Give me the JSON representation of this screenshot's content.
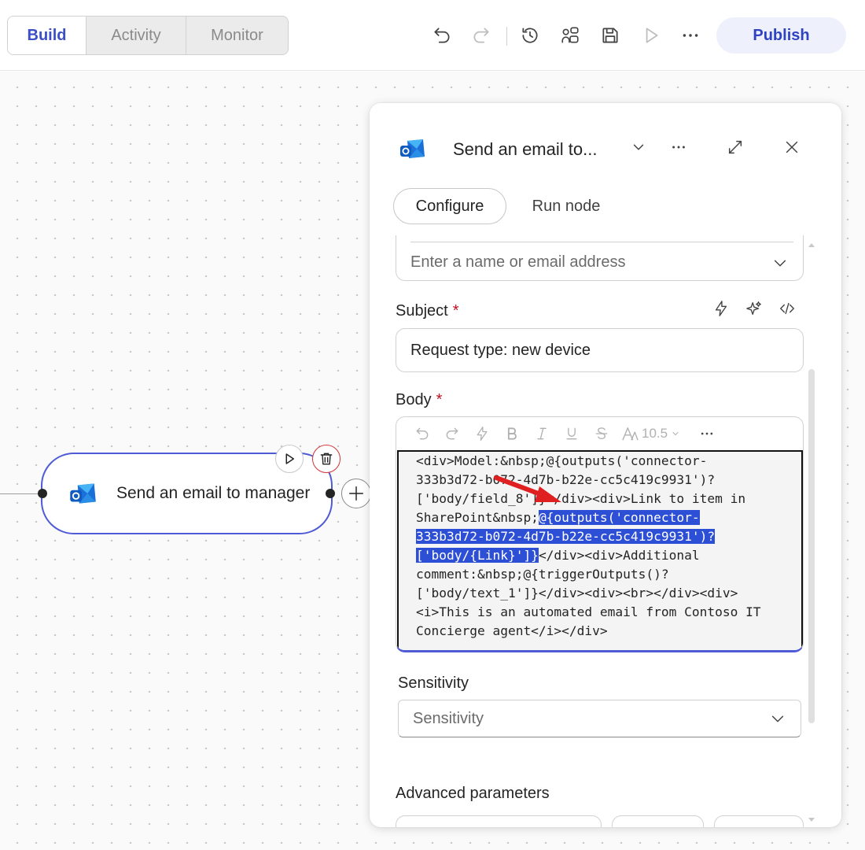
{
  "tabs": [
    {
      "label": "Build",
      "active": true
    },
    {
      "label": "Activity",
      "active": false
    },
    {
      "label": "Monitor",
      "active": false
    }
  ],
  "toolbar": {
    "icons": [
      "undo-icon",
      "redo-icon",
      "version-history-icon",
      "flow-checker-icon",
      "save-icon",
      "test-icon",
      "more-icon"
    ],
    "publish_label": "Publish"
  },
  "node": {
    "label": "Send an email to manager",
    "icon": "outlook-icon",
    "accent": "#4f5bd5"
  },
  "panel": {
    "title": "Send an email to...",
    "tabs": {
      "configure": "Configure",
      "run_node": "Run node"
    },
    "to_placeholder": "Enter a name or email address",
    "subject": {
      "label": "Subject",
      "required": "*",
      "value": "Request type: new device"
    },
    "body": {
      "label": "Body",
      "required": "*",
      "font_size": "10.5",
      "lines": [
        {
          "pre": "<div>Model:&nbsp;@{outputs('connector-",
          "sel": "",
          "post": ""
        },
        {
          "pre": "333b3d72-b072-4d7b-b22e-cc5c419c9931')?",
          "sel": "",
          "post": ""
        },
        {
          "pre": "['body/field_8']}</div><div>Link to item in",
          "sel": "",
          "post": ""
        },
        {
          "pre": "SharePoint&nbsp;",
          "sel": "@{outputs('connector-",
          "post": ""
        },
        {
          "pre": "",
          "sel": "333b3d72-b072-4d7b-b22e-cc5c419c9931')?",
          "post": ""
        },
        {
          "pre": "",
          "sel": "['body/{Link}']}",
          "post": "</div><div>Additional"
        },
        {
          "pre": "comment:&nbsp;@{triggerOutputs()?",
          "sel": "",
          "post": ""
        },
        {
          "pre": "['body/text_1']}</div><div><br></div><div>",
          "sel": "",
          "post": ""
        },
        {
          "pre": "<i>This is an automated email from Contoso IT",
          "sel": "",
          "post": ""
        },
        {
          "pre": "Concierge agent</i></div>",
          "sel": "",
          "post": ""
        }
      ]
    },
    "sensitivity": {
      "label": "Sensitivity",
      "placeholder": "Sensitivity"
    },
    "advanced_label": "Advanced parameters"
  },
  "colors": {
    "primary": "#3b4fc7",
    "selection": "#2d4fd6",
    "required": "#c50f1f",
    "annotation_arrow": "#e02020"
  }
}
